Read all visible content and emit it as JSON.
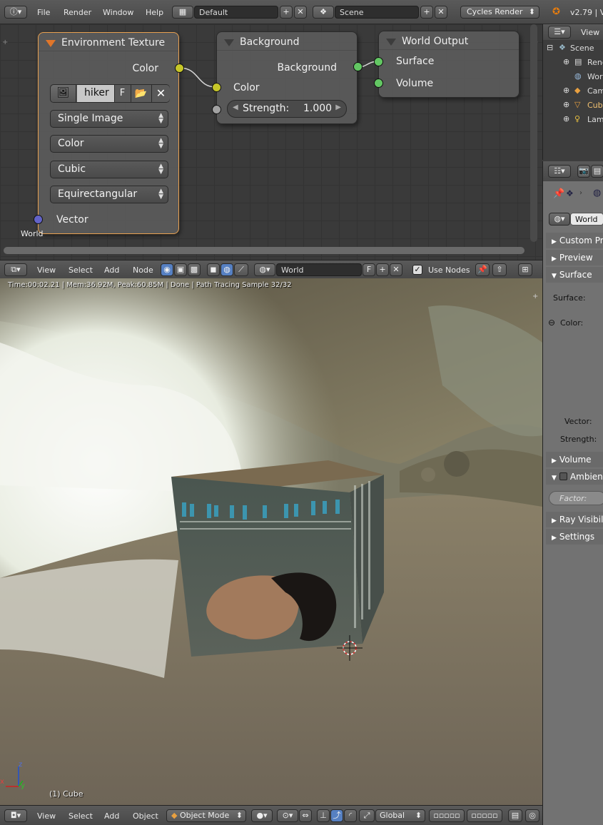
{
  "top_bar": {
    "menus": [
      "File",
      "Render",
      "Window",
      "Help"
    ],
    "screen_layout": "Default",
    "scene": "Scene",
    "render_engine": "Cycles Render",
    "version": "v2.79 | V"
  },
  "node_editor": {
    "env_node": {
      "title": "Environment Texture",
      "out_color": "Color",
      "image_name": "hiker",
      "fake_user": "F",
      "projection_source": "Single Image",
      "color_space": "Color",
      "interpolation": "Cubic",
      "projection": "Equirectangular",
      "in_vector": "Vector",
      "frame_label": "World"
    },
    "bg_node": {
      "title": "Background",
      "out_background": "Background",
      "in_color": "Color",
      "strength_label": "Strength:",
      "strength_value": "1.000"
    },
    "out_node": {
      "title": "World Output",
      "in_surface": "Surface",
      "in_volume": "Volume"
    }
  },
  "node_header": {
    "menus": [
      "View",
      "Select",
      "Add",
      "Node"
    ],
    "world_name": "World",
    "fake_user": "F",
    "use_nodes_label": "Use Nodes"
  },
  "viewport": {
    "info": "Time:00:02.21 | Mem:36.92M, Peak:60.85M | Done | Path Tracing Sample 32/32",
    "object_label": "(1) Cube",
    "axis_z": "z",
    "axis_y": "y",
    "axis_x": "x"
  },
  "viewport_header": {
    "menus": [
      "View",
      "Select",
      "Add",
      "Object"
    ],
    "mode": "Object Mode",
    "orientation": "Global"
  },
  "outliner": {
    "view_label": "View",
    "items": [
      "Scene",
      "Rend",
      "World",
      "Cam",
      "Cube",
      "Lam"
    ]
  },
  "properties": {
    "world_field": "World",
    "panels": {
      "custom_props": "Custom Pro",
      "preview": "Preview",
      "surface": "Surface",
      "volume": "Volume",
      "ambient": "Ambien",
      "ray_visibility": "Ray Visibili",
      "settings": "Settings"
    },
    "labels": {
      "surface": "Surface:",
      "color": "Color:",
      "vector": "Vector:",
      "strength": "Strength:",
      "factor": "Factor:"
    }
  },
  "colors": {
    "active_node_border": "#e8a050",
    "socket_color": "#c7c729",
    "socket_shader": "#63c763",
    "socket_vector": "#6363c7"
  }
}
